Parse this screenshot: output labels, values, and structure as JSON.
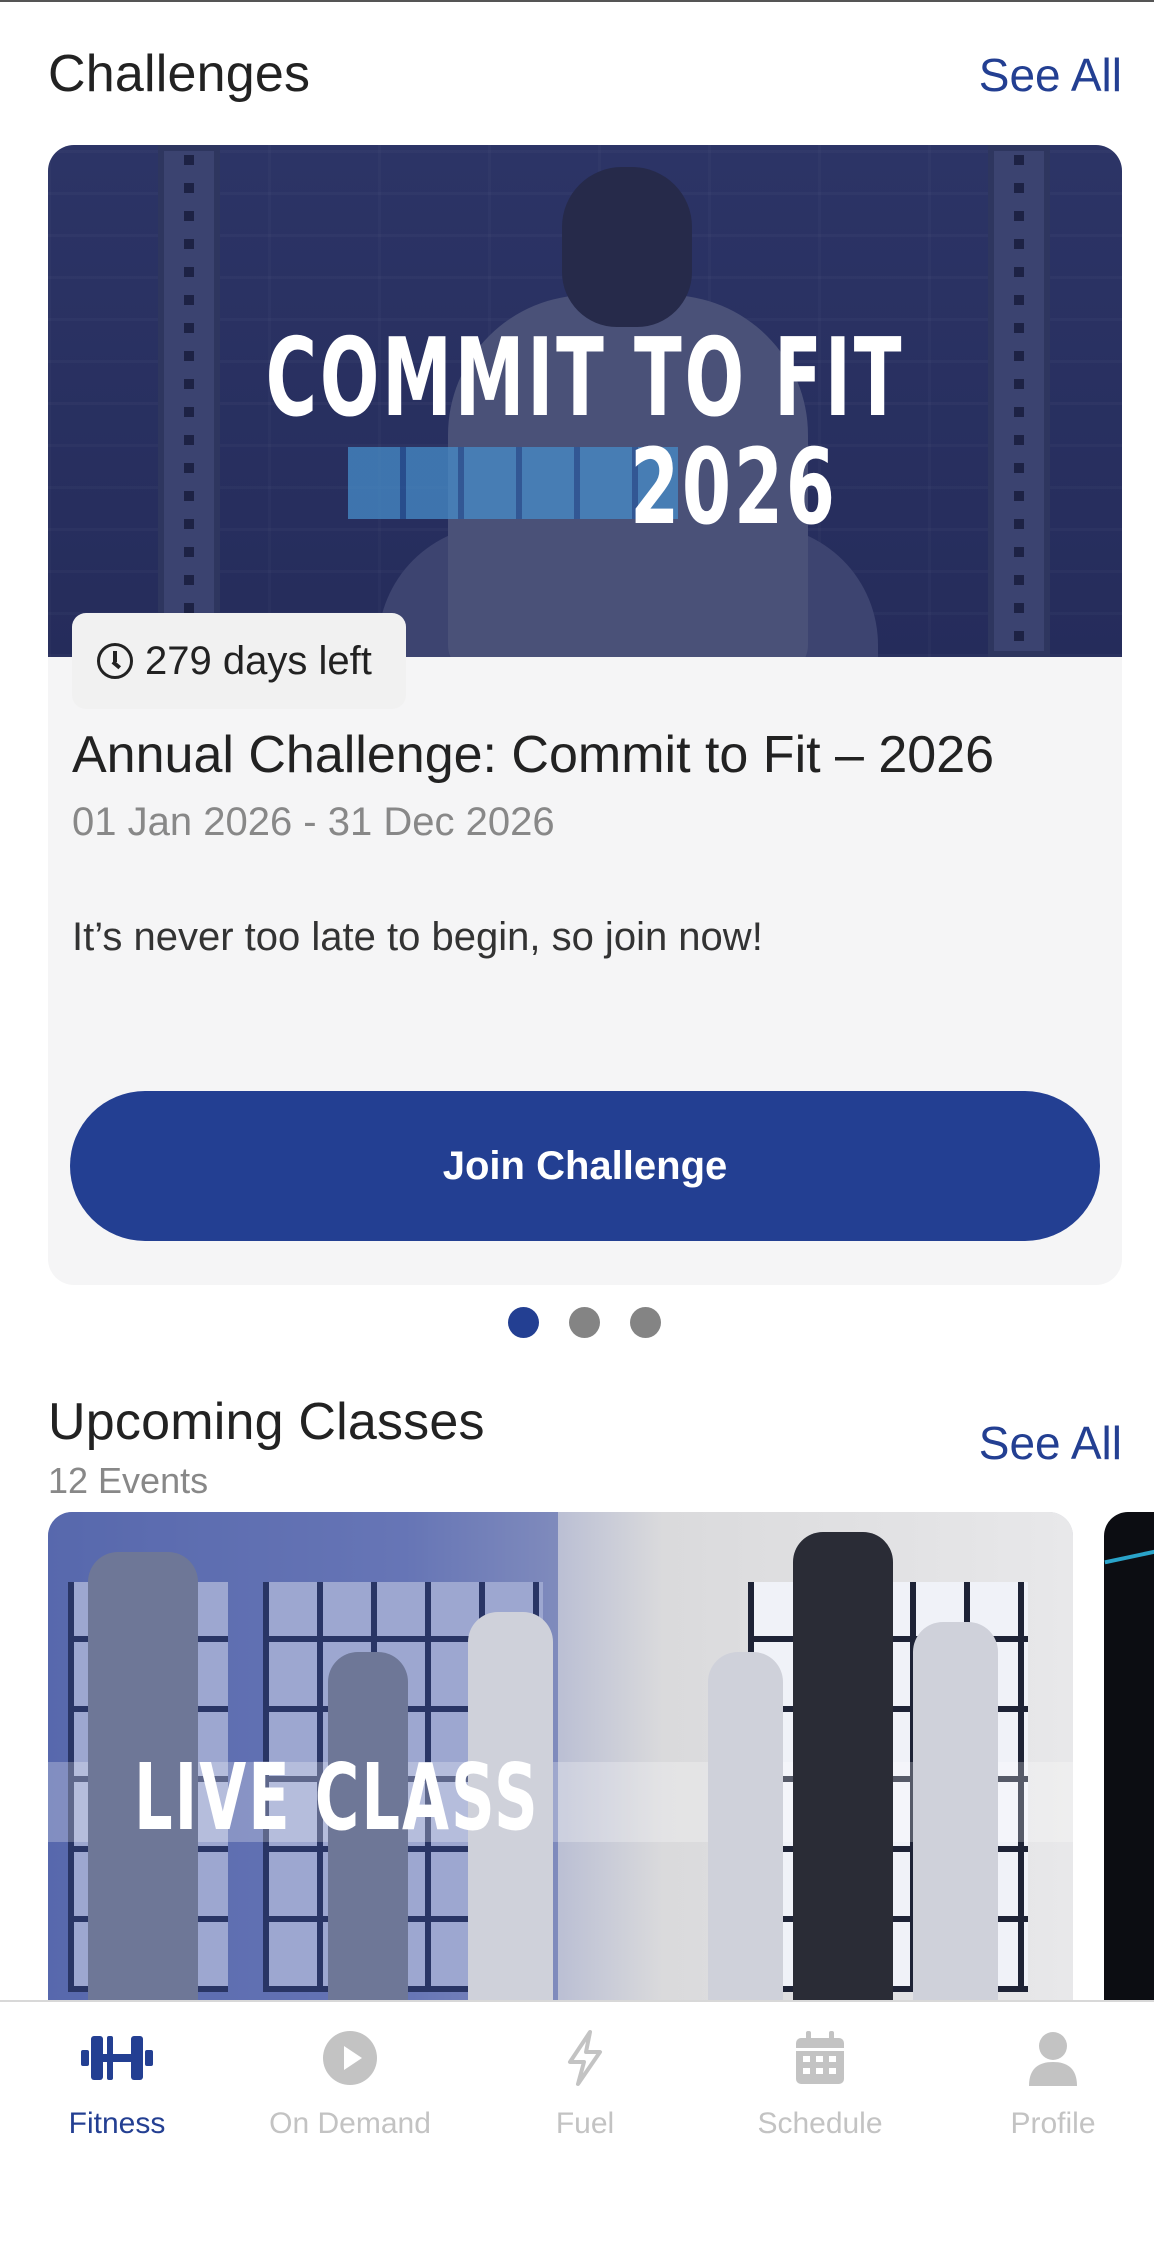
{
  "challenges": {
    "title": "Challenges",
    "see_all": "See All",
    "card": {
      "image_title": "COMMIT TO FIT",
      "image_year": "2026",
      "days_left": "279 days left",
      "title": "Annual Challenge: Commit to Fit – 2026",
      "dates": "01 Jan 2026 - 31 Dec 2026",
      "description": "It’s never too late to begin, so join now!",
      "cta": "Join Challenge"
    },
    "carousel": {
      "count": 3,
      "active_index": 0
    }
  },
  "upcoming": {
    "title": "Upcoming Classes",
    "subtitle": "12 Events",
    "see_all": "See All",
    "card": {
      "image_title": "LIVE CLASS"
    }
  },
  "nav": {
    "items": [
      {
        "label": "Fitness",
        "icon": "dumbbell-icon",
        "active": true
      },
      {
        "label": "On Demand",
        "icon": "play-circle-icon",
        "active": false
      },
      {
        "label": "Fuel",
        "icon": "lightning-icon",
        "active": false
      },
      {
        "label": "Schedule",
        "icon": "calendar-icon",
        "active": false
      },
      {
        "label": "Profile",
        "icon": "person-icon",
        "active": false
      }
    ]
  },
  "colors": {
    "accent": "#233f92",
    "inactive": "#c3c3c3",
    "card_bg": "#f5f5f6",
    "dot_inactive": "#848484"
  }
}
